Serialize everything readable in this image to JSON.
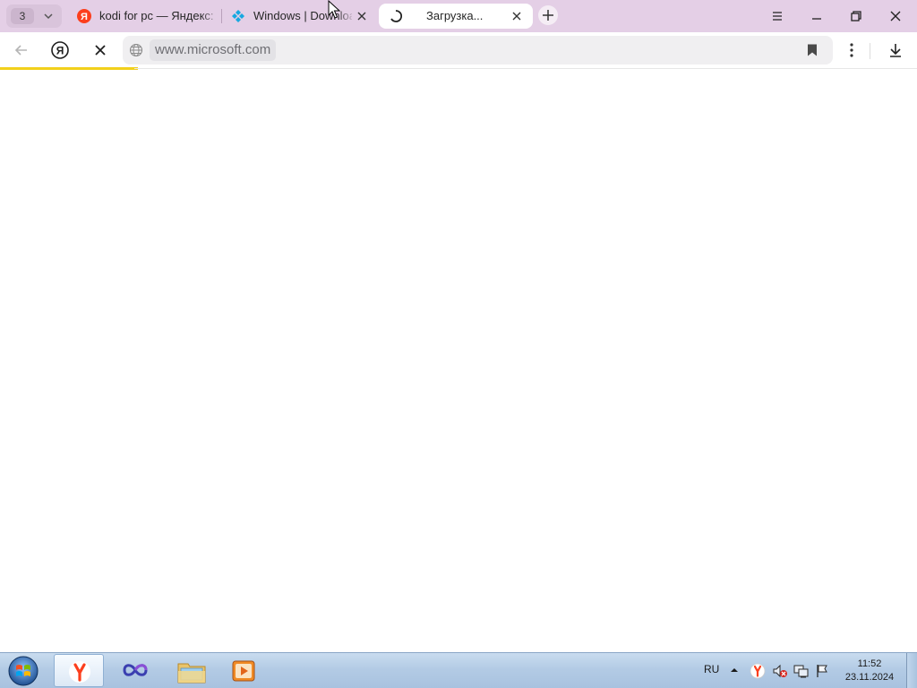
{
  "browser": {
    "tab_count": "3",
    "tabs": [
      {
        "label": "kodi for pc — Яндекс: нашлось",
        "favicon": "yandex-icon",
        "active": false
      },
      {
        "label": "Windows | Download",
        "favicon": "kodi-icon",
        "active": false
      },
      {
        "label": "Загрузка...",
        "favicon": "loading-spinner-icon",
        "active": true
      }
    ],
    "new_tab_icon": "plus-icon",
    "window_controls": [
      "menu-icon",
      "minimize-icon",
      "maximize-icon",
      "close-icon"
    ]
  },
  "toolbar": {
    "back_icon": "back-arrow-icon",
    "home_icon": "yandex-home-icon",
    "stop_icon": "stop-loading-icon",
    "address": "www.microsoft.com",
    "site_icon": "globe-icon",
    "bookmark_icon": "bookmark-icon",
    "menu_icon": "kebab-menu-icon",
    "download_icon": "download-icon",
    "load_progress": 0.15
  },
  "colors": {
    "tabstrip": "#e4cfe6",
    "progress": "#f2d01b",
    "yandex_red": "#fc3f1d"
  },
  "taskbar": {
    "apps": [
      "yandex-browser-icon",
      "loop-app-icon",
      "file-explorer-icon",
      "media-player-icon"
    ],
    "language": "RU",
    "time": "11:52",
    "date": "23.11.2024"
  }
}
